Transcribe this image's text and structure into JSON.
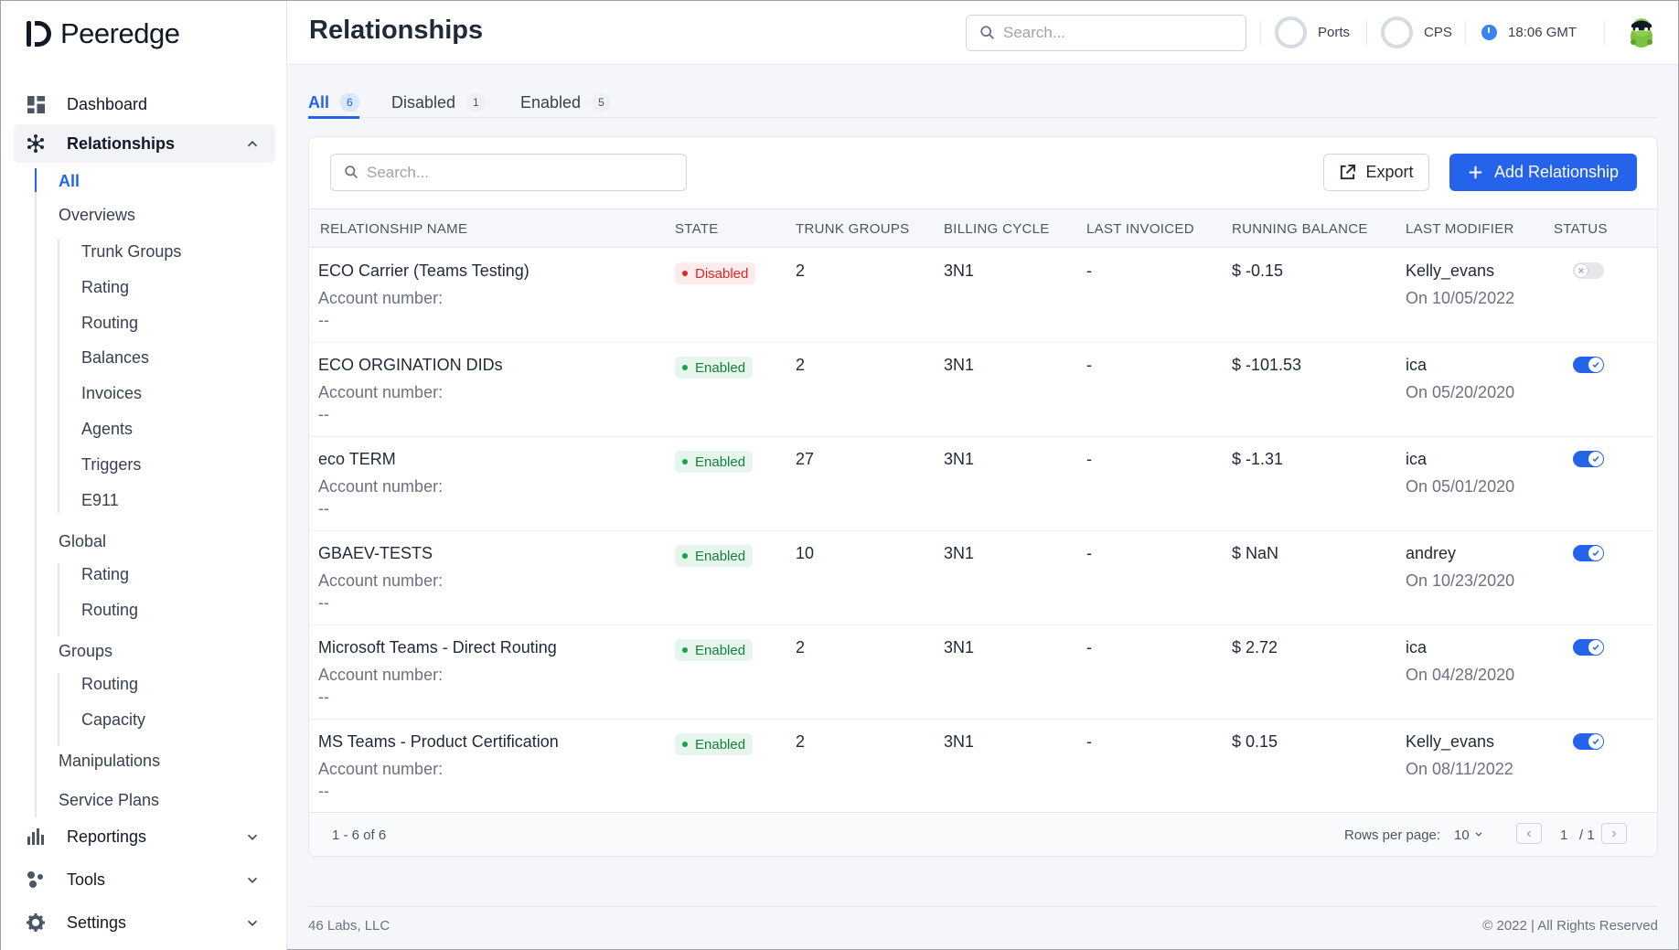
{
  "brand": {
    "name": "Peeredge"
  },
  "sidebar": {
    "dashboard": "Dashboard",
    "relationships": "Relationships",
    "sub": {
      "all": "All",
      "overviews": "Overviews",
      "overview_items": [
        "Trunk Groups",
        "Rating",
        "Routing",
        "Balances",
        "Invoices",
        "Agents",
        "Triggers",
        "E911"
      ],
      "global": "Global",
      "global_items": [
        "Rating",
        "Routing"
      ],
      "groups": "Groups",
      "groups_items": [
        "Routing",
        "Capacity"
      ],
      "manipulations": "Manipulations",
      "service_plans": "Service Plans"
    },
    "reportings": "Reportings",
    "tools": "Tools",
    "settings": "Settings"
  },
  "header": {
    "title": "Relationships",
    "search_placeholder": "Search...",
    "ports_label": "Ports",
    "cps_label": "CPS",
    "time": "18:06 GMT"
  },
  "tabs": [
    {
      "label": "All",
      "count": "6"
    },
    {
      "label": "Disabled",
      "count": "1"
    },
    {
      "label": "Enabled",
      "count": "5"
    }
  ],
  "toolbar": {
    "search_placeholder": "Search...",
    "export_label": "Export",
    "add_label": "Add Relationship"
  },
  "table": {
    "columns": [
      "RELATIONSHIP NAME",
      "STATE",
      "TRUNK GROUPS",
      "BILLING CYCLE",
      "LAST INVOICED",
      "RUNNING BALANCE",
      "LAST MODIFIER",
      "STATUS"
    ],
    "account_label": "Account number:",
    "rows": [
      {
        "name": "ECO Carrier (Teams Testing)",
        "account": "--",
        "state": "Disabled",
        "trunk_groups": "2",
        "billing_cycle": "3N1",
        "last_invoiced": "-",
        "balance": "$ -0.15",
        "modifier": "Kelly_evans",
        "modified_on": "On 10/05/2022",
        "enabled": false
      },
      {
        "name": "ECO ORGINATION DIDs",
        "account": "--",
        "state": "Enabled",
        "trunk_groups": "2",
        "billing_cycle": "3N1",
        "last_invoiced": "-",
        "balance": "$ -101.53",
        "modifier": "ica",
        "modified_on": "On 05/20/2020",
        "enabled": true
      },
      {
        "name": "eco TERM",
        "account": "--",
        "state": "Enabled",
        "trunk_groups": "27",
        "billing_cycle": "3N1",
        "last_invoiced": "-",
        "balance": "$ -1.31",
        "modifier": "ica",
        "modified_on": "On 05/01/2020",
        "enabled": true
      },
      {
        "name": "GBAEV-TESTS",
        "account": "--",
        "state": "Enabled",
        "trunk_groups": "10",
        "billing_cycle": "3N1",
        "last_invoiced": "-",
        "balance": "$ NaN",
        "modifier": "andrey",
        "modified_on": "On 10/23/2020",
        "enabled": true
      },
      {
        "name": "Microsoft Teams - Direct Routing",
        "account": "--",
        "state": "Enabled",
        "trunk_groups": "2",
        "billing_cycle": "3N1",
        "last_invoiced": "-",
        "balance": "$ 2.72",
        "modifier": "ica",
        "modified_on": "On 04/28/2020",
        "enabled": true
      },
      {
        "name": "MS Teams - Product Certification",
        "account": "--",
        "state": "Enabled",
        "trunk_groups": "2",
        "billing_cycle": "3N1",
        "last_invoiced": "-",
        "balance": "$ 0.15",
        "modifier": "Kelly_evans",
        "modified_on": "On 08/11/2022",
        "enabled": true
      }
    ]
  },
  "pagination": {
    "range": "1 - 6 of 6",
    "rows_per_page_label": "Rows per page:",
    "rows_per_page": "10",
    "page": "1",
    "total_pages": "/ 1"
  },
  "footer": {
    "company": "46 Labs, LLC",
    "copyright": "© 2022 | All Rights Reserved"
  },
  "colors": {
    "accent": "#2563eb",
    "enabled": "#15803d",
    "disabled": "#dc2626"
  }
}
